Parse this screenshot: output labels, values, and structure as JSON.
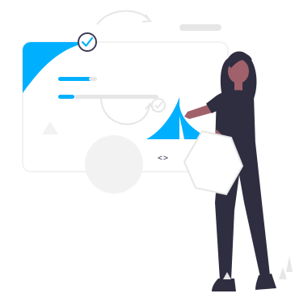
{
  "illustration": {
    "code_symbol": "<>",
    "colors": {
      "accent": "#00B0FF",
      "dark": "#2F2E41",
      "skin": "#A0616A",
      "hair": "#2F2E41",
      "light_gray": "#F2F2F2",
      "mid_gray": "#E6E6E6",
      "outline": "#3F3D56"
    },
    "icons": [
      "check-circle-icon",
      "code-icon",
      "refresh-arrow-icon"
    ]
  }
}
